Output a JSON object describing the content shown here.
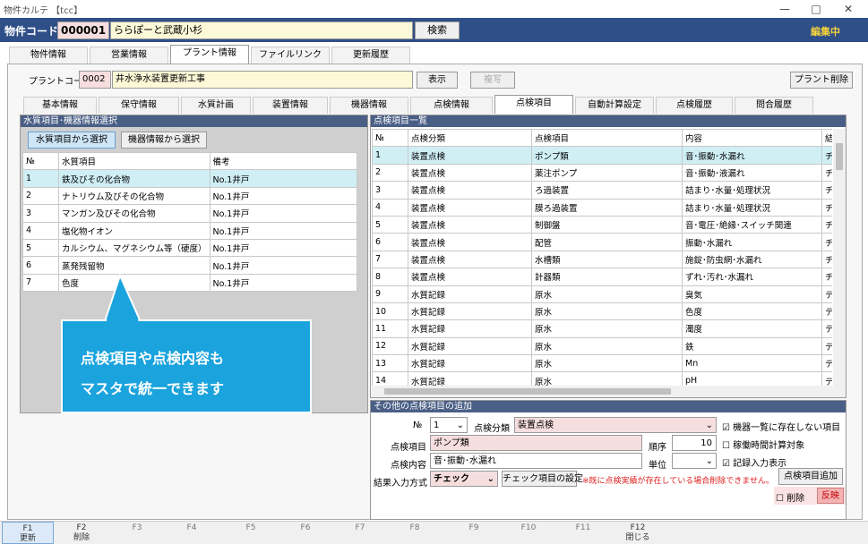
{
  "window": {
    "title": "物件カルテ 【tcc】",
    "minimize": "—",
    "maximize": "□",
    "close": "✕"
  },
  "header": {
    "code_label": "物件コード",
    "code": "000001",
    "name": "ららぽーと武蔵小杉",
    "search": "検索",
    "status": "編集中"
  },
  "main_tabs": [
    "物件情報",
    "営業情報",
    "プラント情報",
    "ファイルリンク",
    "更新履歴"
  ],
  "plant": {
    "code_label": "プラントコード",
    "code": "0002",
    "name": "井水浄水装置更新工事",
    "show": "表示",
    "copy": "複写",
    "delete": "プラント削除"
  },
  "sub_tabs": [
    "基本情報",
    "保守情報",
    "水質計画",
    "装置情報",
    "機器情報",
    "点検情報",
    "点検項目",
    "自動計算設定",
    "点検履歴",
    "問合履歴"
  ],
  "left": {
    "title": "水質項目･機器情報選択",
    "btn1": "水質項目から選択",
    "btn2": "機器情報から選択",
    "headers": [
      "№",
      "水質項目",
      "備考"
    ],
    "rows": [
      [
        "1",
        "鉄及びその化合物",
        "No.1井戸"
      ],
      [
        "2",
        "ナトリウム及びその化合物",
        "No.1井戸"
      ],
      [
        "3",
        "マンガン及びその化合物",
        "No.1井戸"
      ],
      [
        "4",
        "塩化物イオン",
        "No.1井戸"
      ],
      [
        "5",
        "カルシウム、マグネシウム等（硬度）",
        "No.1井戸"
      ],
      [
        "6",
        "蒸発残留物",
        "No.1井戸"
      ],
      [
        "7",
        "色度",
        "No.1井戸"
      ]
    ]
  },
  "callout": {
    "line1": "点検項目や点検内容も",
    "line2": "マスタで統一できます"
  },
  "right": {
    "title": "点検項目一覧",
    "headers": [
      "№",
      "点検分類",
      "点検項目",
      "内容",
      "結"
    ],
    "rows": [
      [
        "1",
        "装置点検",
        "ポンプ類",
        "音･振動･水漏れ",
        "チェ"
      ],
      [
        "2",
        "装置点検",
        "薬注ポンプ",
        "音･振動･液漏れ",
        "チェ"
      ],
      [
        "3",
        "装置点検",
        "ろ過装置",
        "詰まり･水量･処理状況",
        "チェ"
      ],
      [
        "4",
        "装置点検",
        "膜ろ過装置",
        "詰まり･水量･処理状況",
        "チェ"
      ],
      [
        "5",
        "装置点検",
        "制御盤",
        "音･電圧･絶縁･スイッチ関連",
        "チェ"
      ],
      [
        "6",
        "装置点検",
        "配管",
        "振動･水漏れ",
        "チェ"
      ],
      [
        "7",
        "装置点検",
        "水槽類",
        "施錠･防虫網･水漏れ",
        "チェ"
      ],
      [
        "8",
        "装置点検",
        "計器類",
        "ずれ･汚れ･水漏れ",
        "チェ"
      ],
      [
        "9",
        "水質記録",
        "原水",
        "臭気",
        "テキ"
      ],
      [
        "10",
        "水質記録",
        "原水",
        "色度",
        "テキ"
      ],
      [
        "11",
        "水質記録",
        "原水",
        "濁度",
        "テキ"
      ],
      [
        "12",
        "水質記録",
        "原水",
        "鉄",
        "テキ"
      ],
      [
        "13",
        "水質記録",
        "原水",
        "Mn",
        "テキ"
      ],
      [
        "14",
        "水質記録",
        "原水",
        "pH",
        "テキ"
      ]
    ]
  },
  "form": {
    "title": "その他の点検項目の追加",
    "no_label": "№",
    "no": "1",
    "cat_label": "点検分類",
    "cat": "装置点検",
    "chk1": "機器一覧に存在しない項目",
    "item_label": "点検項目",
    "item": "ポンプ類",
    "order_label": "順序",
    "order": "10",
    "chk2": "稼働時間計算対象",
    "content_label": "点検内容",
    "content": "音･振動･水漏れ",
    "unit_label": "単位",
    "unit": "",
    "chk3": "記録入力表示",
    "mode_label": "結果入力方式",
    "mode": "チェック",
    "mode_btn": "チェック項目の設定",
    "warn": "※既に点検実績が存在している場合削除できません。",
    "add": "点検項目追加",
    "del_chk": "削除",
    "apply": "反映"
  },
  "fkeys": [
    [
      "F1",
      "更新"
    ],
    [
      "F2",
      "削除"
    ],
    [
      "F3",
      ""
    ],
    [
      "F4",
      ""
    ],
    [
      "F5",
      ""
    ],
    [
      "F6",
      ""
    ],
    [
      "F7",
      ""
    ],
    [
      "F8",
      ""
    ],
    [
      "F9",
      ""
    ],
    [
      "F10",
      ""
    ],
    [
      "F11",
      ""
    ],
    [
      "F12",
      "閉じる"
    ]
  ],
  "colors": {
    "header": "#2f4f88",
    "callout": "#1aa3dd",
    "status": "#f5d23a"
  }
}
